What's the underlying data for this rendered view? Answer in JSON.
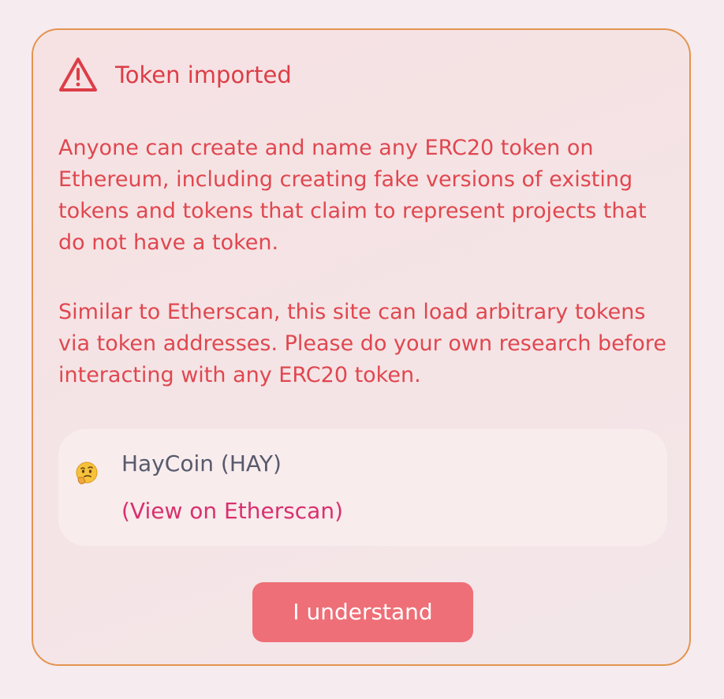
{
  "dialog": {
    "title": "Token imported",
    "icon": "warning-triangle-icon",
    "paragraph1": "Anyone can create and name any ERC20 token on Ethereum, including creating fake versions of existing tokens and tokens that claim to represent projects that do not have a token.",
    "paragraph2": "Similar to Etherscan, this site can load arbitrary tokens via token addresses. Please do your own research before interacting with any ERC20 token.",
    "token": {
      "icon": "thinking-face-emoji-icon",
      "name": "HayCoin (HAY)",
      "link_label": "(View on Etherscan)"
    },
    "confirm_label": "I understand"
  },
  "colors": {
    "accent_red": "#dd3d47",
    "border_orange": "#e3944f",
    "button_bg": "#ee6f77",
    "link_pink": "#d9306e",
    "token_name_gray": "#575a6c",
    "page_bg": "#f6ebef"
  }
}
